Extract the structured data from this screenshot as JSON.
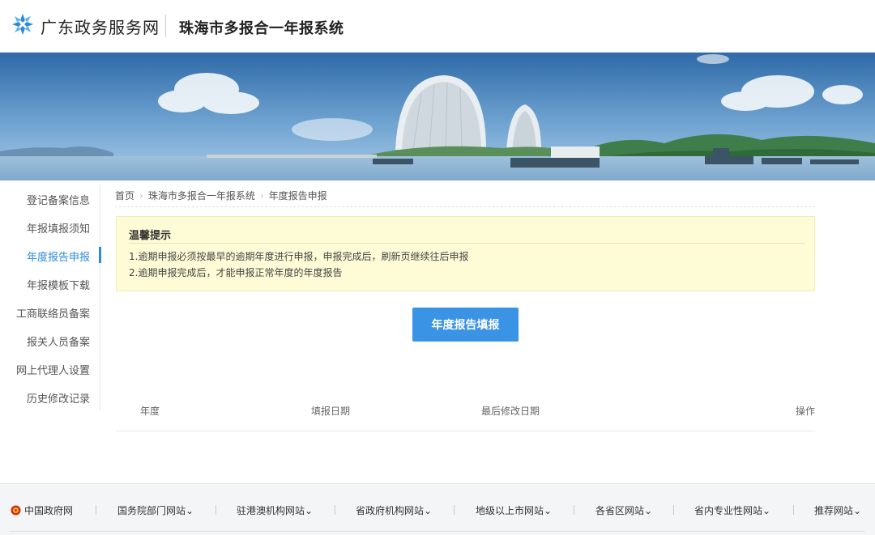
{
  "header": {
    "site_name": "广东政务服务网",
    "system_name": "珠海市多报合一年报系统"
  },
  "sidebar": {
    "items": [
      {
        "label": "登记备案信息"
      },
      {
        "label": "年报填报须知"
      },
      {
        "label": "年度报告申报",
        "active": true
      },
      {
        "label": "年报模板下载"
      },
      {
        "label": "工商联络员备案"
      },
      {
        "label": "报关人员备案"
      },
      {
        "label": "网上代理人设置"
      },
      {
        "label": "历史修改记录"
      }
    ]
  },
  "breadcrumb": [
    "首页",
    "珠海市多报合一年报系统",
    "年度报告申报"
  ],
  "notice": {
    "title": "温馨提示",
    "lines": [
      "1.逾期申报必须按最早的逾期年度进行申报，申报完成后，刷新页继续往后申报",
      "2.逾期申报完成后，才能申报正常年度的年度报告"
    ]
  },
  "actions": {
    "fill_report": "年度报告填报"
  },
  "table": {
    "columns": [
      "年度",
      "填报日期",
      "最后修改日期",
      "操作"
    ]
  },
  "footer": {
    "links": [
      "中国政府网",
      "国务院部门网站",
      "驻港澳机构网站",
      "省政府机构网站",
      "地级以上市网站",
      "各省区网站",
      "省内专业性网站",
      "推荐网站"
    ]
  },
  "colors": {
    "accent": "#3b93e6",
    "notice_bg": "#fefcd6",
    "footer_bg": "#f4f5f7"
  }
}
